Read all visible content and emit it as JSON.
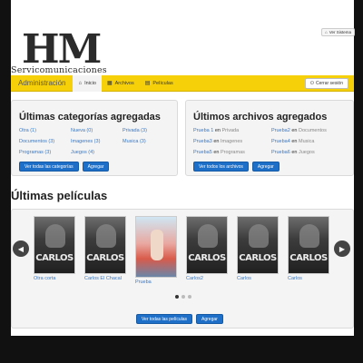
{
  "system_button": {
    "label": "Ver Sistema",
    "icon": "home-icon"
  },
  "logo": {
    "text": "HM",
    "subtitle": "Servicomunicaciones"
  },
  "navbar": {
    "brand": "Administración",
    "items": [
      {
        "label": "Inicio",
        "icon": "home-icon",
        "active": true
      },
      {
        "label": "Archivos",
        "icon": "grid-icon",
        "active": false
      },
      {
        "label": "Películas",
        "icon": "film-icon",
        "active": false
      }
    ],
    "logout": "Cerrar sesión",
    "accent": "#f6d10a"
  },
  "categories": {
    "title": "Últimas categorías agregadas",
    "columns": [
      [
        "Otra (1)",
        "Documentos (3)",
        "Programas (3)"
      ],
      [
        "Nueva (0)",
        "Imagenes (3)",
        "Juegos (4)"
      ],
      [
        "Privada (3)",
        "Musica (3)"
      ]
    ],
    "btn_all": "Ver todas las categorías",
    "btn_add": "Agregar"
  },
  "files": {
    "title": "Últimos archivos agregados",
    "rows": [
      [
        {
          "name": "Prueba 1",
          "sep": "en",
          "cat": "Privada"
        },
        {
          "name": "Prueba2",
          "sep": "en",
          "cat": "Documentos"
        }
      ],
      [
        {
          "name": "Prueba3",
          "sep": "en",
          "cat": "Imagenes"
        },
        {
          "name": "Prueba4",
          "sep": "en",
          "cat": "Musica"
        }
      ],
      [
        {
          "name": "Prueba5",
          "sep": "en",
          "cat": "Programas"
        },
        {
          "name": "Prueba6",
          "sep": "en",
          "cat": "Juegos"
        }
      ]
    ],
    "btn_all": "Ver todos los archivos",
    "btn_add": "Agregar"
  },
  "movies": {
    "title": "Últimas películas",
    "items": [
      {
        "caption": "Otra corta",
        "poster_text": "CARLOS",
        "style": "dark"
      },
      {
        "caption": "Carlos El Chacal",
        "poster_text": "CARLOS",
        "style": "dark"
      },
      {
        "caption": "Prueba",
        "poster_text": "",
        "style": "light"
      },
      {
        "caption": "Carlos2",
        "poster_text": "CARLOS",
        "style": "dark"
      },
      {
        "caption": "Carlos",
        "poster_text": "CARLOS",
        "style": "dark"
      },
      {
        "caption": "Carlos",
        "poster_text": "CARLOS",
        "style": "dark"
      }
    ],
    "btn_all": "Ver todas las películas",
    "btn_add": "Agregar",
    "pages": 3,
    "current_page": 1
  }
}
